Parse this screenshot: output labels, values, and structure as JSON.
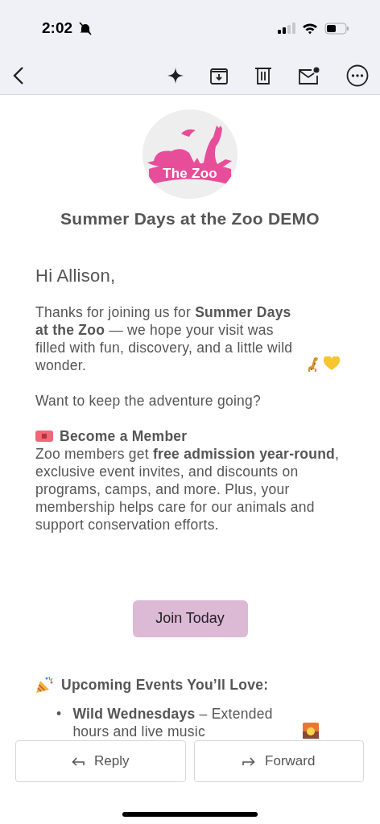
{
  "status_bar": {
    "time": "2:02"
  },
  "logo": {
    "text": "The Zoo"
  },
  "subject": "Summer Days at the Zoo DEMO",
  "greeting": "Hi Allison,",
  "intro": "Thanks for joining us for **Summer Days at the Zoo** — we hope your visit was filled with fun, discovery, and a little wild wonder.",
  "question": "Want to keep the adventure going?",
  "member": {
    "heading": "Become a Member",
    "body": "Zoo members get **free admission year-round**, exclusive event invites, and discounts on programs, camps, and more. Plus, your membership helps care for our animals and support conservation efforts."
  },
  "cta": "Join Today",
  "events": {
    "heading": "Upcoming Events You’ll Love:",
    "items": [
      {
        "marker": "•",
        "name": "Wild Wednesdays",
        "text": " – Extended hours and live music"
      }
    ]
  },
  "actions": [
    {
      "kind": "reply",
      "label": "Reply"
    },
    {
      "kind": "forward",
      "label": "Forward"
    }
  ]
}
